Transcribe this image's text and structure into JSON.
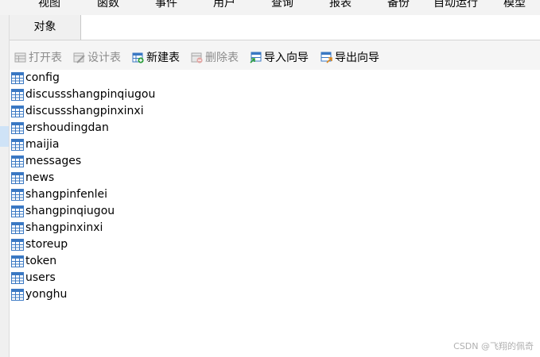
{
  "menu": [
    "视图",
    "函数",
    "事件",
    "用户",
    "查询",
    "报表",
    "备份",
    "自动运行",
    "模型"
  ],
  "tabs": [
    {
      "label": "对象"
    }
  ],
  "toolbar": {
    "buttons": [
      {
        "label": "打开表",
        "icon": "open-table-icon",
        "enabled": false
      },
      {
        "label": "设计表",
        "icon": "design-table-icon",
        "enabled": false
      },
      {
        "label": "新建表",
        "icon": "new-table-icon",
        "enabled": true
      },
      {
        "label": "删除表",
        "icon": "delete-table-icon",
        "enabled": false
      },
      {
        "label": "导入向导",
        "icon": "import-wizard-icon",
        "enabled": true
      },
      {
        "label": "导出向导",
        "icon": "export-wizard-icon",
        "enabled": true
      }
    ]
  },
  "tables": [
    "config",
    "discussshangpinqiugou",
    "discussshangpinxinxi",
    "ershoudingdan",
    "maijia",
    "messages",
    "news",
    "shangpinfenlei",
    "shangpinqiugou",
    "shangpinxinxi",
    "storeup",
    "token",
    "users",
    "yonghu"
  ],
  "watermark": "CSDN @飞翔的佩奇",
  "colors": {
    "table_icon": "#3a78c3",
    "accent_green": "#2e9e3e",
    "accent_red": "#d9534f",
    "disabled_text": "#8c8c8c"
  }
}
